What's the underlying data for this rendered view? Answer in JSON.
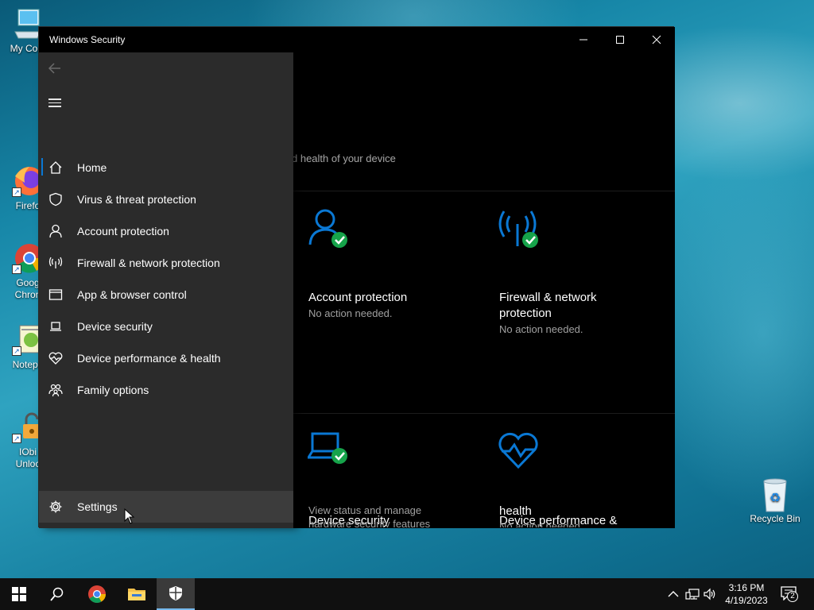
{
  "desktop": {
    "icons": [
      {
        "label": "My Com",
        "name": "desktop-icon-my-computer"
      },
      {
        "label": "Firefo",
        "name": "desktop-icon-firefox"
      },
      {
        "label": "Goog Chron",
        "name": "desktop-icon-google-chrome"
      },
      {
        "label": "Notepa",
        "name": "desktop-icon-notepad"
      },
      {
        "label": "IObi Unloc",
        "name": "desktop-icon-iobit-unlocker"
      },
      {
        "label": "Recycle Bin",
        "name": "desktop-icon-recycle-bin"
      }
    ]
  },
  "window": {
    "title": "Windows Security",
    "controls": {
      "minimize": "–",
      "maximize": "☐",
      "close": "✕"
    }
  },
  "nav": {
    "back_icon": "back-arrow-icon",
    "items": [
      {
        "label": "Home",
        "icon": "home-icon",
        "selected": true
      },
      {
        "label": "Virus & threat protection",
        "icon": "shield-icon"
      },
      {
        "label": "Account protection",
        "icon": "person-icon"
      },
      {
        "label": "Firewall & network protection",
        "icon": "antenna-icon"
      },
      {
        "label": "App & browser control",
        "icon": "browser-window-icon"
      },
      {
        "label": "Device security",
        "icon": "laptop-icon"
      },
      {
        "label": "Device performance & health",
        "icon": "heart-icon"
      },
      {
        "label": "Family options",
        "icon": "family-icon"
      }
    ],
    "settings": {
      "label": "Settings",
      "icon": "gear-icon",
      "hovered": true
    }
  },
  "main": {
    "subtitle_partial": "d health of your device",
    "tiles": [
      {
        "title": "Account protection",
        "desc": "No action needed."
      },
      {
        "title_line1": "Firewall & network",
        "title_line2": "protection",
        "desc": "No action needed."
      },
      {
        "title": "Device security",
        "desc_line1": "View status and manage",
        "desc_line2": "hardware security features"
      },
      {
        "title_line1": "Device performance &",
        "title_line2": "health",
        "desc": "No action needed."
      }
    ]
  },
  "taskbar": {
    "items": [
      "start-button",
      "search-button",
      "chrome-taskbar",
      "file-explorer-taskbar",
      "windows-security-taskbar"
    ],
    "clock": {
      "time": "3:16 PM",
      "date": "4/19/2023"
    },
    "notification_count": "2"
  },
  "colors": {
    "accent_blue": "#0a78d4",
    "ok_green": "#16a34a",
    "nav_bg": "#2b2b2b"
  }
}
